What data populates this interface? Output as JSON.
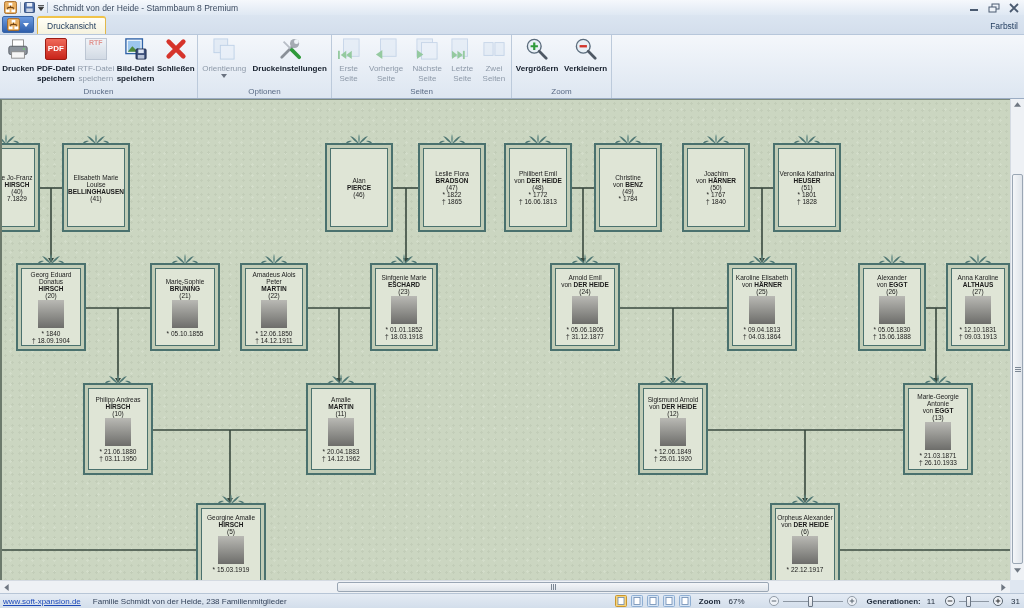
{
  "window": {
    "title": "Schmidt von der Heide - Stammbaum 8 Premium"
  },
  "tabs": [
    {
      "label": "Druckansicht",
      "selected": true
    }
  ],
  "style_menu": {
    "label": "Farbstil"
  },
  "ribbon_groups": [
    {
      "label": "Drucken",
      "buttons": [
        {
          "label": "Drucken",
          "disabled": false,
          "dropdown": false
        },
        {
          "label": "PDF-Datei\nspeichern",
          "icon_text": "PDF",
          "disabled": false,
          "dropdown": false
        },
        {
          "label": "RTF-Datei\nspeichern",
          "icon_text": "RTF",
          "disabled": true,
          "dropdown": false
        },
        {
          "label": "Bild-Datei\nspeichern",
          "disabled": false,
          "dropdown": false
        },
        {
          "label": "Schließen",
          "disabled": false,
          "dropdown": false
        }
      ]
    },
    {
      "label": "Optionen",
      "buttons": [
        {
          "label": "Orientierung",
          "disabled": true,
          "dropdown": true
        },
        {
          "label": "Druckeinstellungen",
          "disabled": false,
          "dropdown": false
        }
      ]
    },
    {
      "label": "Seiten",
      "buttons": [
        {
          "label": "Erste\nSeite",
          "disabled": true,
          "dropdown": false
        },
        {
          "label": "Vorherige\nSeite",
          "disabled": true,
          "dropdown": false
        },
        {
          "label": "Nächste\nSeite",
          "disabled": true,
          "dropdown": false
        },
        {
          "label": "Letzte\nSeite",
          "disabled": true,
          "dropdown": false
        },
        {
          "label": "Zwei\nSeiten",
          "disabled": true,
          "dropdown": false
        }
      ]
    },
    {
      "label": "Zoom",
      "buttons": [
        {
          "label": "Vergrößern",
          "disabled": false,
          "dropdown": false
        },
        {
          "label": "Verkleinern",
          "disabled": false,
          "dropdown": false
        }
      ]
    }
  ],
  "family_tree": {
    "people": [
      {
        "given": "e Jo-Franz",
        "surname": "HIRSCH",
        "number": "(40)",
        "dates": [
          "7.1829"
        ],
        "photo": false
      },
      {
        "given": "Elisabeth Marie Louise",
        "surname": "BELLINGHAUSEN",
        "number": "(41)",
        "photo": false
      },
      {
        "given": "Alan",
        "surname": "PIERCE",
        "number": "(46)",
        "photo": false
      },
      {
        "given": "Leslie Flora",
        "surname": "BRADSON",
        "number": "(47)",
        "dates": [
          "* 1822",
          "† 1865"
        ],
        "photo": false
      },
      {
        "given": "Philibert Emil",
        "particle": "von",
        "surname": "DER HEIDE",
        "number": "(48)",
        "dates": [
          "* 1772",
          "† 16.06.1813"
        ],
        "photo": false
      },
      {
        "given": "Christine",
        "particle": "von",
        "surname": "BENZ",
        "number": "(49)",
        "dates": [
          "* 1784"
        ],
        "photo": false
      },
      {
        "given": "Joachim",
        "particle": "von",
        "surname": "HÄRNER",
        "number": "(50)",
        "dates": [
          "* 1767",
          "† 1840"
        ],
        "photo": false
      },
      {
        "given": "Veronika Katharina",
        "surname": "HEUSER",
        "number": "(51)",
        "dates": [
          "* 1801",
          "† 1828"
        ],
        "photo": false
      },
      {
        "given": "Georg Eduard Donatus",
        "surname": "HIRSCH",
        "number": "(20)",
        "dates": [
          "* 1840",
          "† 18.09.1904"
        ],
        "photo": true
      },
      {
        "given": "Marie-Sophie",
        "surname": "BRÜNING",
        "number": "(21)",
        "dates": [
          "* 05.10.1855"
        ],
        "photo": true
      },
      {
        "given": "Amadeus Alois Peter",
        "surname": "MARTIN",
        "number": "(22)",
        "dates": [
          "* 12.06.1850",
          "† 14.12.1911"
        ],
        "photo": true
      },
      {
        "given": "Sinfgenie Marie",
        "surname": "ESCHARD",
        "number": "(23)",
        "dates": [
          "* 01.01.1852",
          "† 18.03.1918"
        ],
        "photo": true
      },
      {
        "given": "Arnold Emil",
        "particle": "von",
        "surname": "DER HEIDE",
        "number": "(24)",
        "dates": [
          "* 05.06.1805",
          "† 31.12.1877"
        ],
        "photo": true
      },
      {
        "given": "Karoline Elisabeth",
        "particle": "von",
        "surname": "HÄRNER",
        "number": "(25)",
        "dates": [
          "* 09.04.1813",
          "† 04.03.1864"
        ],
        "photo": true
      },
      {
        "given": "Alexander",
        "particle": "von",
        "surname": "EGGT",
        "number": "(26)",
        "dates": [
          "* 05.05.1830",
          "† 15.06.1888"
        ],
        "photo": true
      },
      {
        "given": "Anna Karoline",
        "surname": "ALTHAUS",
        "number": "(27)",
        "dates": [
          "* 12.10.1831",
          "† 09.03.1913"
        ],
        "photo": true
      },
      {
        "given": "Philipp Andreas",
        "surname": "HIRSCH",
        "number": "(10)",
        "dates": [
          "* 21.06.1880",
          "† 03.11.1950"
        ],
        "photo": true
      },
      {
        "given": "Amalie",
        "surname": "MARTIN",
        "number": "(11)",
        "dates": [
          "* 20.04.1883",
          "† 14.12.1962"
        ],
        "photo": true
      },
      {
        "given": "Sigismund Arnold",
        "particle": "von",
        "surname": "DER HEIDE",
        "number": "(12)",
        "dates": [
          "* 12.06.1849",
          "† 25.01.1920"
        ],
        "photo": true
      },
      {
        "given": "Marie-Georgie Antonie",
        "particle": "von",
        "surname": "EGGT",
        "number": "(13)",
        "dates": [
          "* 21.03.1871",
          "† 26.10.1933"
        ],
        "photo": true
      },
      {
        "given": "Georgine Amalie",
        "surname": "HIRSCH",
        "number": "(5)",
        "dates": [
          "* 15.03.1919"
        ],
        "photo": true
      },
      {
        "given": "Orpheus Alexander",
        "particle": "von",
        "surname": "DER HEIDE",
        "number": "(6)",
        "dates": [
          "* 22.12.1917"
        ],
        "photo": true
      }
    ]
  },
  "status_bar": {
    "link": "www.soft-xpansion.de",
    "info": "Familie Schmidt von der Heide, 238 Familienmitglieder",
    "view_buttons": [
      {
        "selected": true
      },
      {
        "selected": false
      },
      {
        "selected": false
      },
      {
        "selected": false
      },
      {
        "selected": false
      }
    ],
    "zoom": {
      "label": "Zoom",
      "value": "67%",
      "level": 0.45
    },
    "generations": {
      "label": "Generationen:",
      "value": "11",
      "level": 0.3,
      "max": "31"
    }
  }
}
